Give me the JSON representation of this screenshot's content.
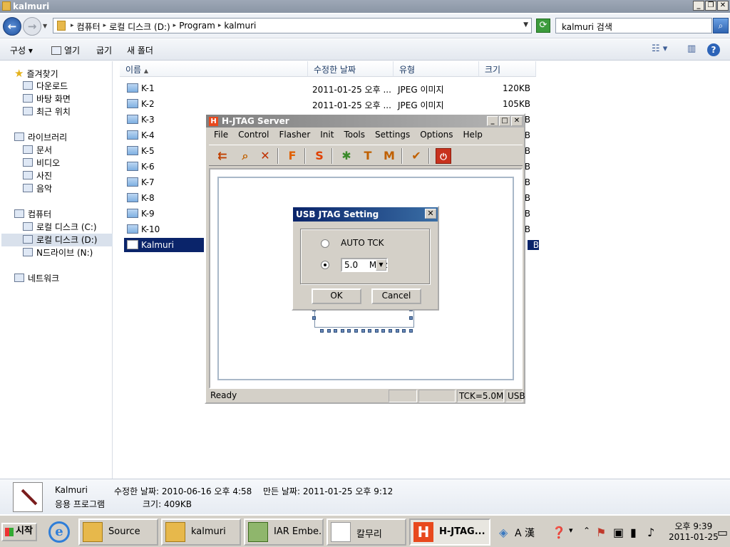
{
  "explorer": {
    "title": "kalmuri",
    "breadcrumb": [
      "컴퓨터",
      "로컬 디스크 (D:)",
      "Program",
      "kalmuri"
    ],
    "search_placeholder": "kalmuri 검색",
    "commands": {
      "organize": "구성",
      "open": "열기",
      "burn": "굽기",
      "new_folder": "새 폴더"
    },
    "sidebar": {
      "favorites": "즐겨찾기",
      "favorites_items": [
        "다운로드",
        "바탕 화면",
        "최근 위치"
      ],
      "libraries": "라이브러리",
      "libraries_items": [
        "문서",
        "비디오",
        "사진",
        "음악"
      ],
      "computer": "컴퓨터",
      "computer_items": [
        "로컬 디스크 (C:)",
        "로컬 디스크 (D:)",
        "N드라이브 (N:)"
      ],
      "network": "네트워크"
    },
    "columns": {
      "name": "이름",
      "modified": "수정한 날짜",
      "type": "유형",
      "size": "크기"
    },
    "files": [
      {
        "name": "K-1",
        "date": "2011-01-25 오후 ...",
        "type": "JPEG 이미지",
        "size": "120KB"
      },
      {
        "name": "K-2",
        "date": "2011-01-25 오후 ...",
        "type": "JPEG 이미지",
        "size": "105KB"
      },
      {
        "name": "K-3",
        "date": "",
        "type": "",
        "size": "B"
      },
      {
        "name": "K-4",
        "date": "",
        "type": "",
        "size": "B"
      },
      {
        "name": "K-5",
        "date": "",
        "type": "",
        "size": "B"
      },
      {
        "name": "K-6",
        "date": "",
        "type": "",
        "size": "B"
      },
      {
        "name": "K-7",
        "date": "",
        "type": "",
        "size": "B"
      },
      {
        "name": "K-8",
        "date": "",
        "type": "",
        "size": "B"
      },
      {
        "name": "K-9",
        "date": "",
        "type": "",
        "size": "B"
      },
      {
        "name": "K-10",
        "date": "",
        "type": "",
        "size": "B"
      },
      {
        "name": "Kalmuri",
        "date": "",
        "type": "",
        "size": "B"
      }
    ],
    "details": {
      "name": "Kalmuri",
      "kind": "응용 프로그램",
      "modified": "수정한 날짜: 2010-06-16 오후 4:58",
      "created": "만든 날짜: 2011-01-25 오후 9:12",
      "size": "크기: 409KB"
    }
  },
  "hjtag": {
    "title": "H-JTAG Server",
    "logo_letter": "H",
    "menu": [
      "File",
      "Control",
      "Flasher",
      "Init",
      "Tools",
      "Settings",
      "Options",
      "Help"
    ],
    "status": {
      "ready": "Ready",
      "tck": "TCK=5.0M",
      "mode": "USB"
    }
  },
  "usb_dialog": {
    "title": "USB JTAG Setting",
    "auto_label": "AUTO   TCK",
    "freq_value": "5.0",
    "freq_unit": "MHz",
    "selected_option": "manual",
    "ok": "OK",
    "cancel": "Cancel"
  },
  "taskbar": {
    "start": "시작",
    "buttons": [
      "Source",
      "kalmuri",
      "IAR Embe...",
      "칼무리",
      "H-JTAG..."
    ],
    "active": "H-JTAG...",
    "ime": "A 漢",
    "clock_time": "오후 9:39",
    "clock_date": "2011-01-25"
  }
}
